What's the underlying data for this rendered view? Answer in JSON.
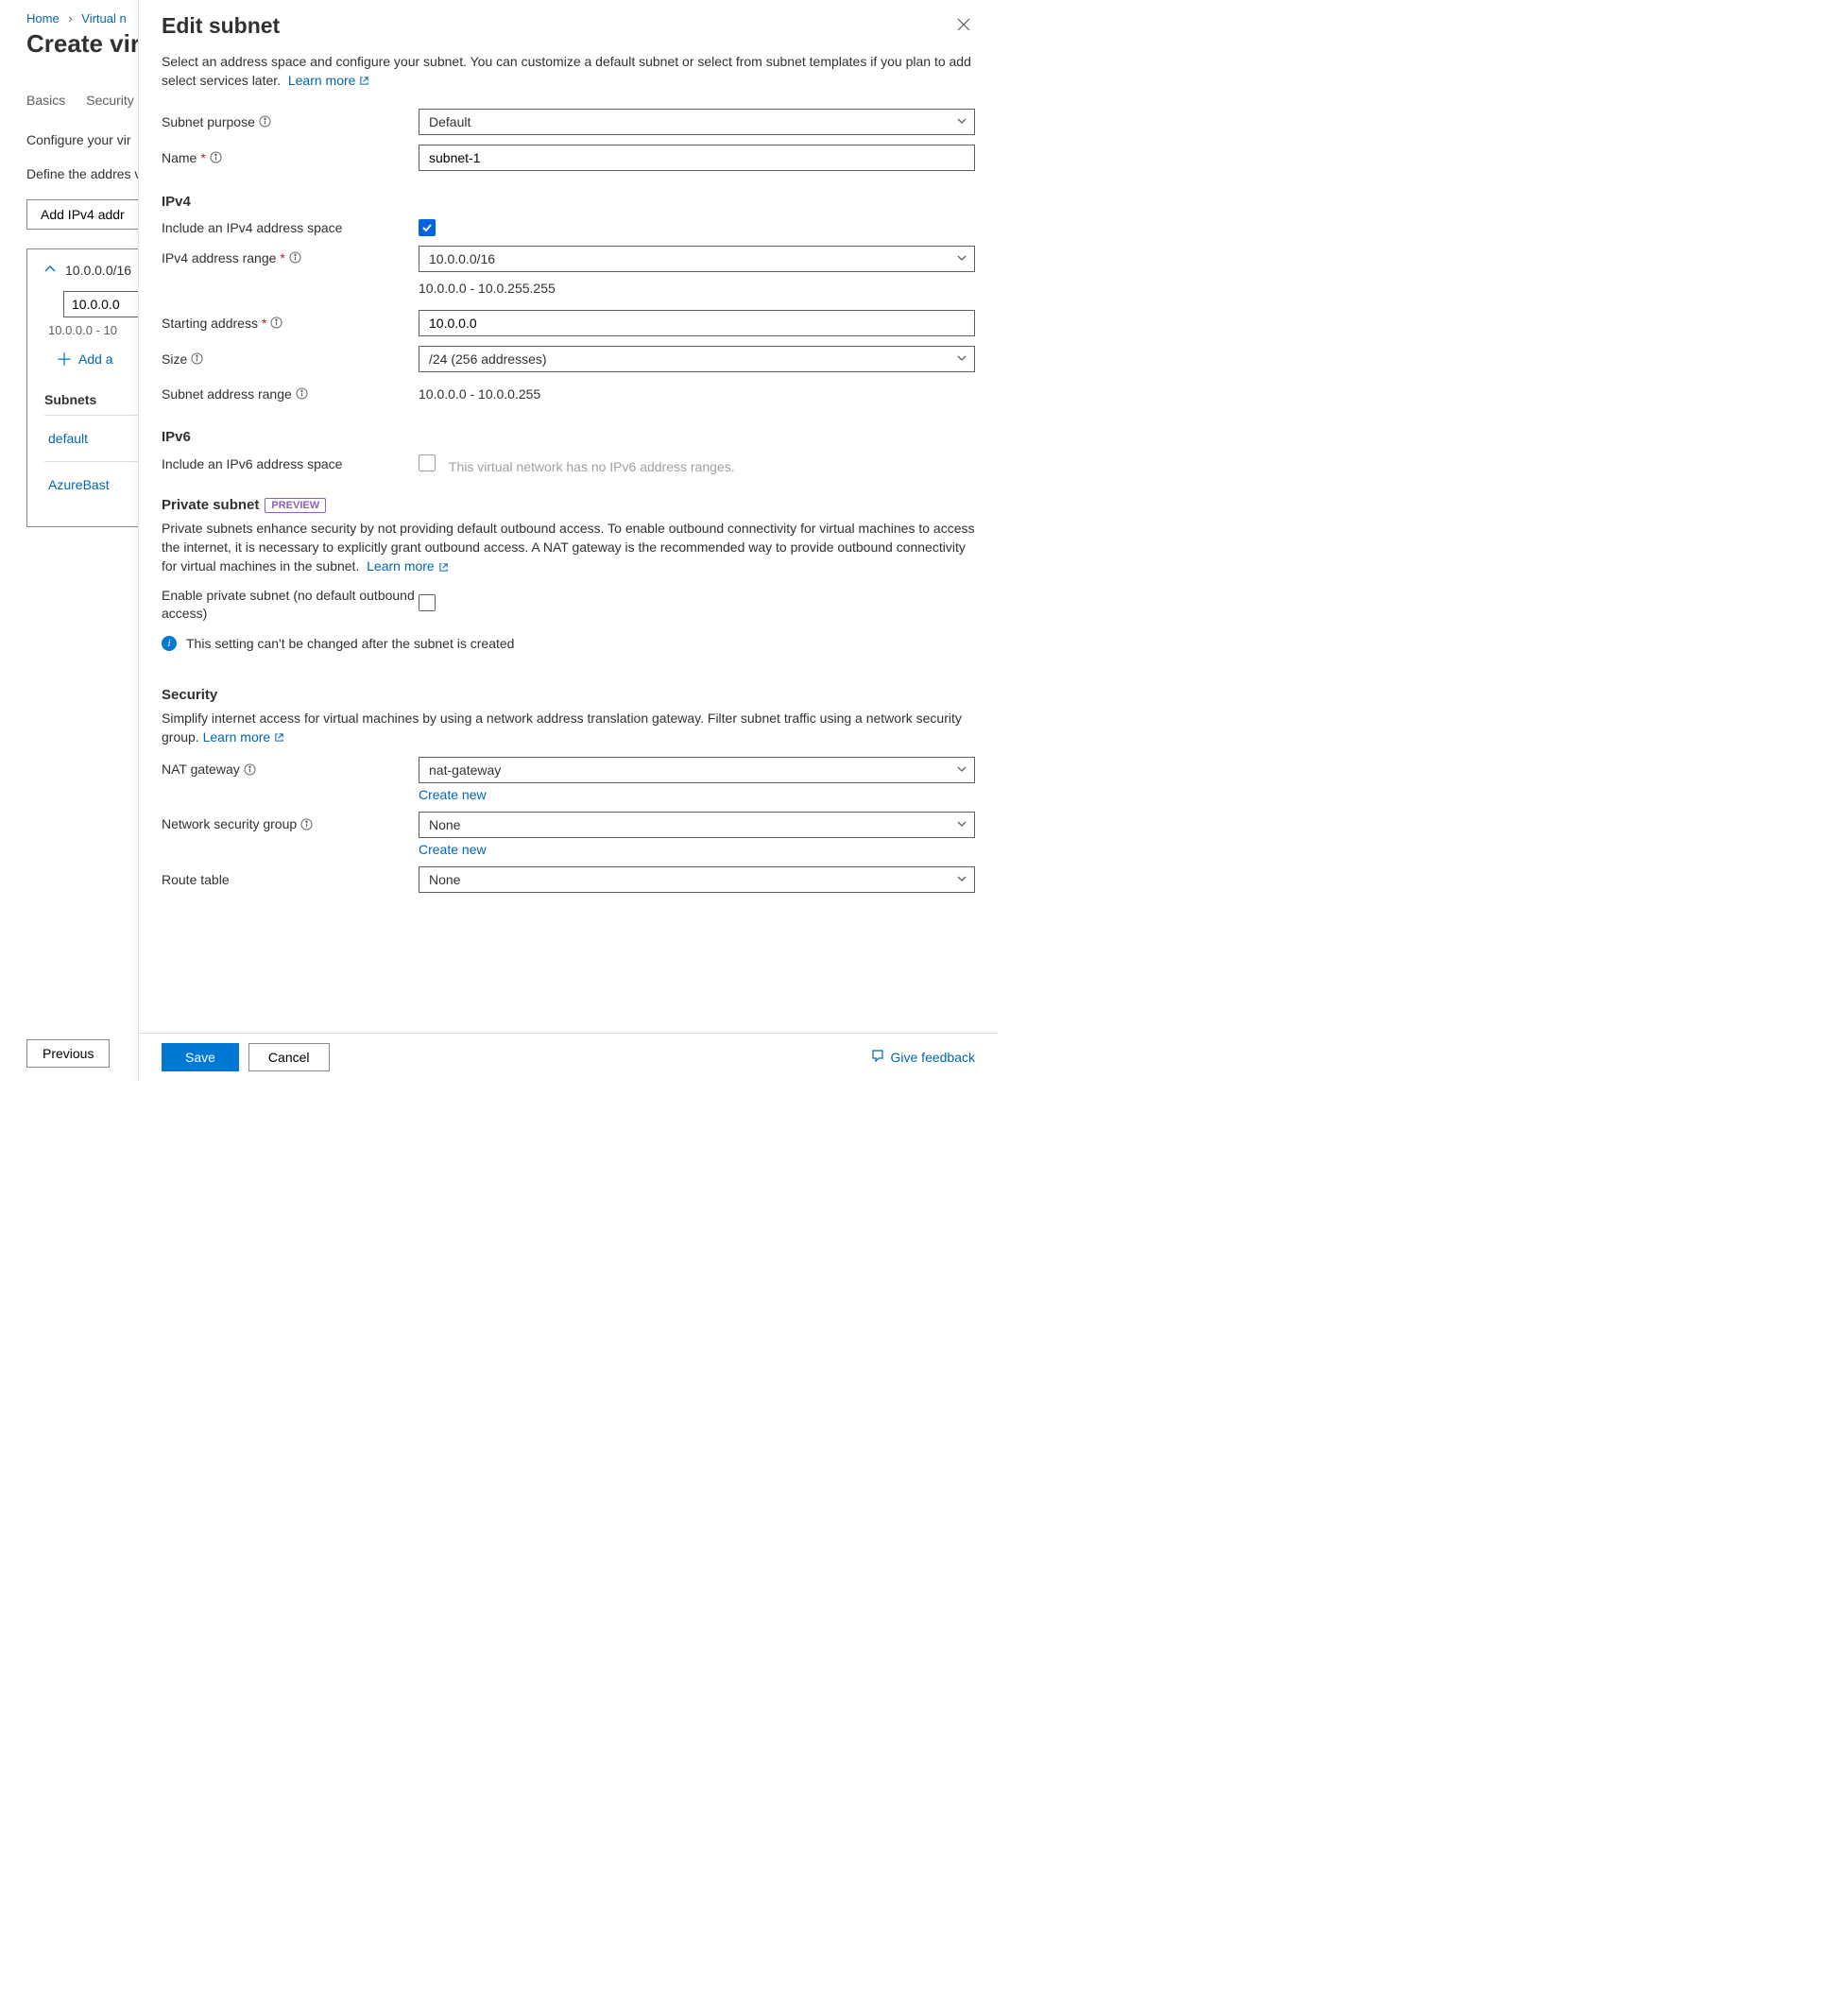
{
  "breadcrumb": {
    "home": "Home",
    "virtual": "Virtual n"
  },
  "page": {
    "title": "Create virt",
    "tabs": [
      "Basics",
      "Security"
    ],
    "intro1": "Configure your vir",
    "intro2": "Define the addres virtual network ad assigns the resour",
    "addBtn": "Add IPv4 addr",
    "ipBlock": {
      "cidr": "10.0.0.0/16",
      "addr": "10.0.0.0",
      "range": "10.0.0.0 - 10",
      "addSubnet": "Add a",
      "subnetsHeading": "Subnets",
      "subnets": [
        "default",
        "AzureBast"
      ]
    },
    "prevBtn": "Previous"
  },
  "blade": {
    "title": "Edit subnet",
    "intro": "Select an address space and configure your subnet. You can customize a default subnet or select from subnet templates if you plan to add select services later.",
    "learnMore": "Learn more",
    "fields": {
      "subnetPurpose": {
        "label": "Subnet purpose",
        "value": "Default"
      },
      "name": {
        "label": "Name",
        "value": "subnet-1"
      }
    },
    "ipv4": {
      "heading": "IPv4",
      "include": {
        "label": "Include an IPv4 address space",
        "checked": true
      },
      "range": {
        "label": "IPv4 address range",
        "value": "10.0.0.0/16",
        "hint": "10.0.0.0 - 10.0.255.255"
      },
      "start": {
        "label": "Starting address",
        "value": "10.0.0.0"
      },
      "size": {
        "label": "Size",
        "value": "/24 (256 addresses)"
      },
      "subnetRange": {
        "label": "Subnet address range",
        "value": "10.0.0.0 - 10.0.0.255"
      }
    },
    "ipv6": {
      "heading": "IPv6",
      "include": {
        "label": "Include an IPv6 address space",
        "hint": "This virtual network has no IPv6 address ranges."
      }
    },
    "private": {
      "heading": "Private subnet",
      "pill": "PREVIEW",
      "desc": "Private subnets enhance security by not providing default outbound access. To enable outbound connectivity for virtual machines to access the internet, it is necessary to explicitly grant outbound access. A NAT gateway is the recommended way to provide outbound connectivity for virtual machines in the subnet.",
      "learnMore": "Learn more",
      "enable": {
        "label": "Enable private subnet (no default outbound access)"
      },
      "note": "This setting can't be changed after the subnet is created"
    },
    "security": {
      "heading": "Security",
      "desc": "Simplify internet access for virtual machines by using a network address translation gateway. Filter subnet traffic using a network security group.",
      "learnMore": "Learn more",
      "nat": {
        "label": "NAT gateway",
        "value": "nat-gateway",
        "createNew": "Create new"
      },
      "nsg": {
        "label": "Network security group",
        "value": "None",
        "createNew": "Create new"
      },
      "route": {
        "label": "Route table",
        "value": "None"
      }
    },
    "footer": {
      "save": "Save",
      "cancel": "Cancel",
      "feedback": "Give feedback"
    }
  }
}
